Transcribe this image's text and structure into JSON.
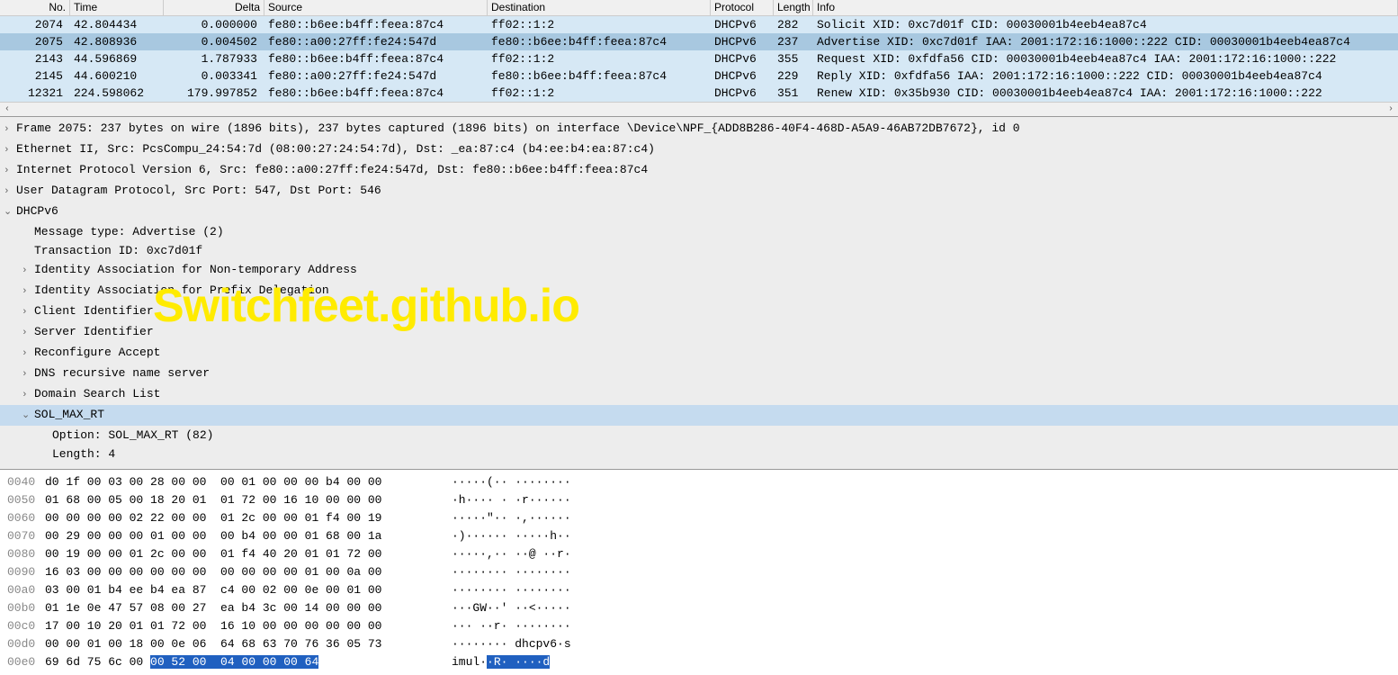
{
  "columns": {
    "no": "No.",
    "time": "Time",
    "delta": "Delta",
    "source": "Source",
    "dest": "Destination",
    "proto": "Protocol",
    "len": "Length",
    "info": "Info"
  },
  "packets": [
    {
      "no": "2074",
      "time": "42.804434",
      "delta": "0.000000",
      "src": "fe80::b6ee:b4ff:feea:87c4",
      "dst": "ff02::1:2",
      "proto": "DHCPv6",
      "len": "282",
      "info": "Solicit XID: 0xc7d01f CID: 00030001b4eeb4ea87c4",
      "cls": "row-lightblue"
    },
    {
      "no": "2075",
      "time": "42.808936",
      "delta": "0.004502",
      "src": "fe80::a00:27ff:fe24:547d",
      "dst": "fe80::b6ee:b4ff:feea:87c4",
      "proto": "DHCPv6",
      "len": "237",
      "info": "Advertise XID: 0xc7d01f IAA: 2001:172:16:1000::222 CID: 00030001b4eeb4ea87c4",
      "cls": "row-selected"
    },
    {
      "no": "2143",
      "time": "44.596869",
      "delta": "1.787933",
      "src": "fe80::b6ee:b4ff:feea:87c4",
      "dst": "ff02::1:2",
      "proto": "DHCPv6",
      "len": "355",
      "info": "Request XID: 0xfdfa56 CID: 00030001b4eeb4ea87c4 IAA: 2001:172:16:1000::222",
      "cls": "row-lightblue"
    },
    {
      "no": "2145",
      "time": "44.600210",
      "delta": "0.003341",
      "src": "fe80::a00:27ff:fe24:547d",
      "dst": "fe80::b6ee:b4ff:feea:87c4",
      "proto": "DHCPv6",
      "len": "229",
      "info": "Reply XID: 0xfdfa56 IAA: 2001:172:16:1000::222 CID: 00030001b4eeb4ea87c4",
      "cls": "row-lightblue"
    },
    {
      "no": "12321",
      "time": "224.598062",
      "delta": "179.997852",
      "src": "fe80::b6ee:b4ff:feea:87c4",
      "dst": "ff02::1:2",
      "proto": "DHCPv6",
      "len": "351",
      "info": "Renew XID: 0x35b930 CID: 00030001b4eeb4ea87c4 IAA: 2001:172:16:1000::222",
      "cls": "row-lightblue"
    }
  ],
  "tree": [
    {
      "ind": 0,
      "tog": "›",
      "text": "Frame 2075: 237 bytes on wire (1896 bits), 237 bytes captured (1896 bits) on interface \\Device\\NPF_{ADD8B286-40F4-468D-A5A9-46AB72DB7672}, id 0"
    },
    {
      "ind": 0,
      "tog": "›",
      "text": "Ethernet II, Src: PcsCompu_24:54:7d (08:00:27:24:54:7d), Dst:        _ea:87:c4 (b4:ee:b4:ea:87:c4)"
    },
    {
      "ind": 0,
      "tog": "›",
      "text": "Internet Protocol Version 6, Src: fe80::a00:27ff:fe24:547d, Dst: fe80::b6ee:b4ff:feea:87c4"
    },
    {
      "ind": 0,
      "tog": "›",
      "text": "User Datagram Protocol, Src Port: 547, Dst Port: 546"
    },
    {
      "ind": 0,
      "tog": "⌄",
      "text": "DHCPv6"
    },
    {
      "ind": 1,
      "tog": "",
      "text": "Message type: Advertise (2)"
    },
    {
      "ind": 1,
      "tog": "",
      "text": "Transaction ID: 0xc7d01f"
    },
    {
      "ind": 1,
      "tog": "›",
      "text": "Identity Association for Non-temporary Address"
    },
    {
      "ind": 1,
      "tog": "›",
      "text": "Identity Association for Prefix Delegation"
    },
    {
      "ind": 1,
      "tog": "›",
      "text": "Client Identifier"
    },
    {
      "ind": 1,
      "tog": "›",
      "text": "Server Identifier"
    },
    {
      "ind": 1,
      "tog": "›",
      "text": "Reconfigure Accept"
    },
    {
      "ind": 1,
      "tog": "›",
      "text": "DNS recursive name server"
    },
    {
      "ind": 1,
      "tog": "›",
      "text": "Domain Search List"
    },
    {
      "ind": 1,
      "tog": "⌄",
      "text": "SOL_MAX_RT",
      "sel": true
    },
    {
      "ind": 2,
      "tog": "",
      "text": "Option: SOL_MAX_RT (82)"
    },
    {
      "ind": 2,
      "tog": "",
      "text": "Length: 4"
    }
  ],
  "hex": [
    {
      "off": "0040",
      "b": "d0 1f 00 03 00 28 00 00  00 01 00 00 00 b4 00 00",
      "a": "·····(·· ········"
    },
    {
      "off": "0050",
      "b": "01 68 00 05 00 18 20 01  01 72 00 16 10 00 00 00",
      "a": "·h···· · ·r······"
    },
    {
      "off": "0060",
      "b": "00 00 00 00 02 22 00 00  01 2c 00 00 01 f4 00 19",
      "a": "·····\"·· ·,······"
    },
    {
      "off": "0070",
      "b": "00 29 00 00 00 01 00 00  00 b4 00 00 01 68 00 1a",
      "a": "·)······ ·····h··"
    },
    {
      "off": "0080",
      "b": "00 19 00 00 01 2c 00 00  01 f4 40 20 01 01 72 00",
      "a": "·····,·· ··@ ··r·"
    },
    {
      "off": "0090",
      "b": "16 03 00 00 00 00 00 00  00 00 00 00 01 00 0a 00",
      "a": "········ ········"
    },
    {
      "off": "00a0",
      "b": "03 00 01 b4 ee b4 ea 87  c4 00 02 00 0e 00 01 00",
      "a": "········ ········"
    },
    {
      "off": "00b0",
      "b": "01 1e 0e 47 57 08 00 27  ea b4 3c 00 14 00 00 00",
      "a": "···GW··' ··<·····"
    },
    {
      "off": "00c0",
      "b": "17 00 10 20 01 01 72 00  16 10 00 00 00 00 00 00",
      "a": "··· ··r· ········"
    },
    {
      "off": "00d0",
      "b": "00 00 01 00 18 00 0e 06  64 68 63 70 76 36 05 73",
      "a": "········ dhcpv6·s"
    },
    {
      "off": "00e0",
      "b1": "69 6d 75 6c 00 ",
      "bhl": "00 52 00  04 00 00 00 64",
      "a1": "imul·",
      "ahl": "·R· ····d"
    }
  ],
  "watermark": "Switchfeet.github.io"
}
